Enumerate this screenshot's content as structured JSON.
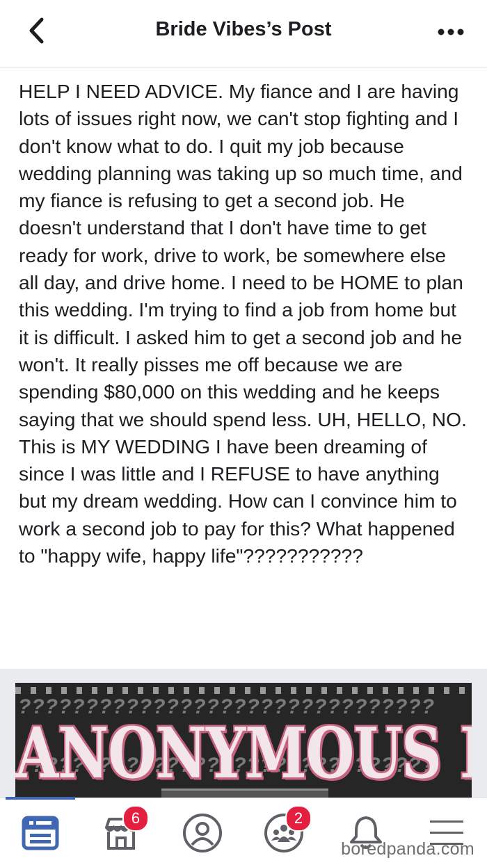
{
  "header": {
    "title": "Bride Vibes’s Post",
    "back_icon": "chevron-left-icon",
    "more_icon": "more-horizontal-icon"
  },
  "post": {
    "text": "HELP I NEED ADVICE. My fiance and I are having lots of issues right now, we can't stop fighting and I don't know what to do. I quit my job because wedding planning was taking up so much time, and my fiance is refusing to get a second job. He doesn't understand that I don't have time to get ready for work, drive to work, be somewhere else all day, and drive home. I need to be HOME to plan this wedding. I'm trying to find a job from home but it is difficult. I asked him to get a second job and he won't. It really pisses me off because we are spending $80,000 on this wedding and he keeps saying that we should spend less. UH, HELLO, NO. This is MY WEDDING I have been dreaming of since I was little and I REFUSE to have anything but my dream wedding. How can I convince him to work a second job to pay for this? What happened to \"happy wife, happy life\"???????????",
    "image": {
      "banner_title": "ANONYMOUS POST",
      "banner_pattern": "???????????????????????????????"
    }
  },
  "tabbar": {
    "tabs": [
      {
        "icon": "news-feed-icon",
        "active": true,
        "badge": ""
      },
      {
        "icon": "marketplace-icon",
        "active": false,
        "badge": "6"
      },
      {
        "icon": "profile-icon",
        "active": false,
        "badge": ""
      },
      {
        "icon": "groups-icon",
        "active": false,
        "badge": "2"
      },
      {
        "icon": "notifications-bell-icon",
        "active": false,
        "badge": ""
      },
      {
        "icon": "menu-icon",
        "active": false,
        "badge": ""
      }
    ]
  },
  "watermark": "boredpanda.com",
  "colors": {
    "accent": "#4267b2",
    "badge": "#e41e3f",
    "icon_gray": "#5f6166",
    "text": "#1c1e21"
  }
}
